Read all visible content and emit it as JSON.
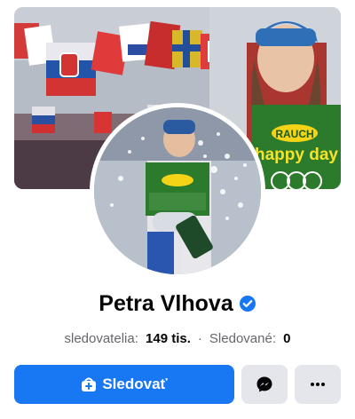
{
  "profile": {
    "name": "Petra Vlhova",
    "verified": true,
    "followers_label": "sledovatelia:",
    "followers_value": "149 tis.",
    "separator": "·",
    "following_label": "Sledované:",
    "following_value": "0"
  },
  "cover": {
    "description_icon": "cover-photo",
    "bib_brand": "RAUCH",
    "bib_text": "happy day"
  },
  "avatar": {
    "description_icon": "profile-photo"
  },
  "actions": {
    "follow_label": "Sledovať",
    "follow_icon": "follow-icon",
    "message_icon": "messenger-icon",
    "more_icon": "more-icon"
  },
  "colors": {
    "accent": "#1877f2",
    "secondary_button": "#e4e6eb",
    "text_primary": "#050505",
    "text_secondary": "#65676b"
  }
}
